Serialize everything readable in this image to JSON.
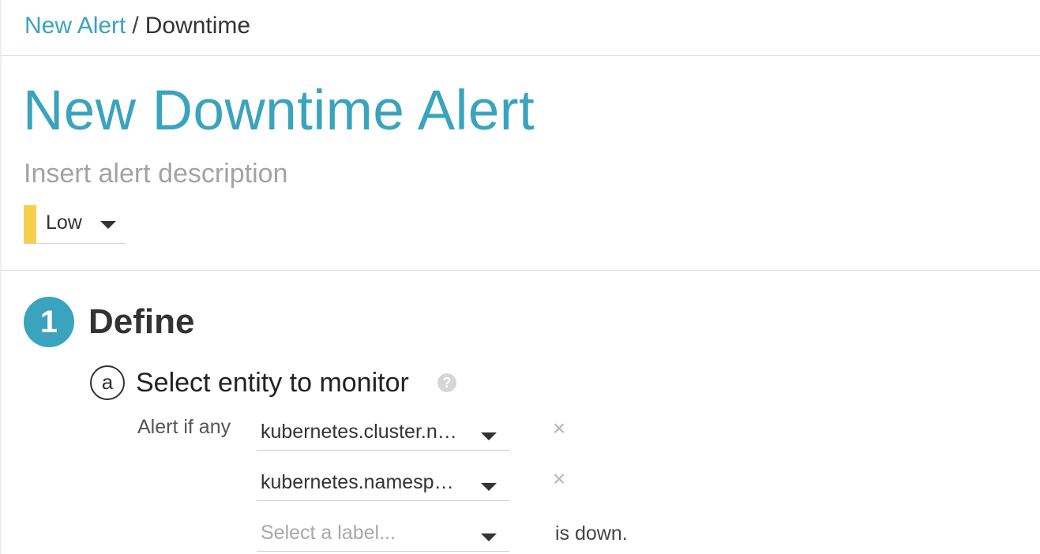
{
  "breadcrumb": {
    "link_label": "New Alert",
    "separator": "/",
    "current_label": "Downtime"
  },
  "page_title": "New Downtime Alert",
  "description": {
    "placeholder": "Insert alert description",
    "value": ""
  },
  "severity": {
    "value": "Low",
    "color": "#f6d04d"
  },
  "step": {
    "number": "1",
    "title": "Define"
  },
  "entity_section": {
    "letter": "a",
    "title": "Select entity to monitor",
    "help_icon": "?",
    "condition_label": "Alert if any",
    "selectors": [
      {
        "value": "kubernetes.cluster.n…"
      },
      {
        "value": "kubernetes.namesp…"
      },
      {
        "placeholder": "Select a label..."
      }
    ],
    "remove_icon": "×",
    "suffix": "is down."
  },
  "colors": {
    "accent": "#3aa3bd",
    "severity_low": "#f6d04d"
  }
}
